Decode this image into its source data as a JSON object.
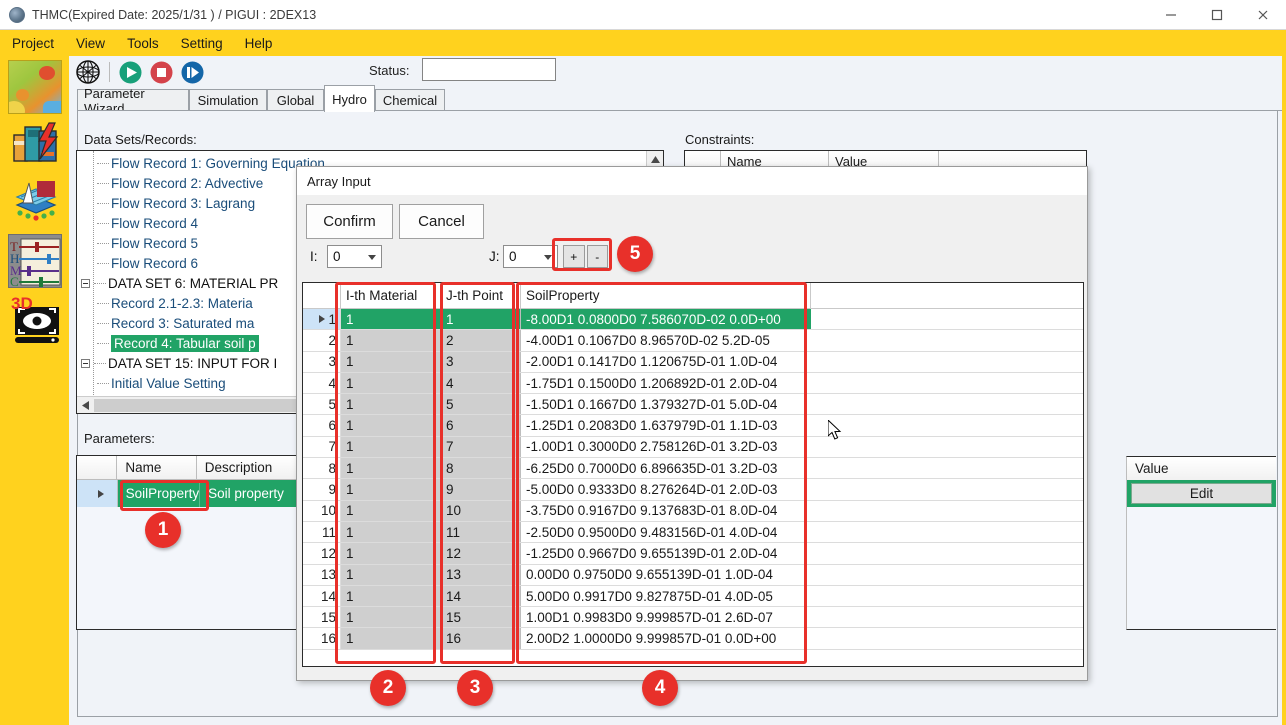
{
  "window": {
    "title": "THMC(Expired Date: 2025/1/31 ) / PIGUI : 2DEX13",
    "minimize": "—",
    "maximize": "□",
    "close": "✕"
  },
  "menubar": {
    "items": [
      {
        "label": "Project"
      },
      {
        "label": "View"
      },
      {
        "label": "Tools"
      },
      {
        "label": "Setting"
      },
      {
        "label": "Help"
      }
    ]
  },
  "toolbar": {
    "globe_icon": "globe-wireframe-icon",
    "run_icon": "run-play-icon",
    "stop_icon": "stop-icon",
    "step_icon": "step-forward-icon",
    "status_label": "Status:",
    "status_value": ""
  },
  "tabs": [
    {
      "label": "Parameter Wizard",
      "active": false
    },
    {
      "label": "Simulation",
      "active": false
    },
    {
      "label": "Global",
      "active": false
    },
    {
      "label": "Hydro",
      "active": true
    },
    {
      "label": "Chemical",
      "active": false
    }
  ],
  "rail": {
    "items": [
      {
        "name": "contour-map-icon"
      },
      {
        "name": "flash-books-icon"
      },
      {
        "name": "mesh-layers-icon"
      },
      {
        "name": "thmc-sliders-icon"
      },
      {
        "name": "3d-view-icon"
      }
    ],
    "thmc_letters": [
      "T",
      "H",
      "M",
      "C"
    ],
    "three_d_label": "3D"
  },
  "sections": {
    "datasets_label": "Data Sets/Records:",
    "constraints_label": "Constraints:",
    "parameters_label": "Parameters:"
  },
  "tree": {
    "nodes": [
      {
        "label": "Flow Record 1: Governing Equation",
        "depth": 2,
        "type": "leaf",
        "selected": false
      },
      {
        "label": "Flow Record 2: Advective",
        "depth": 2,
        "type": "leaf",
        "selected": false
      },
      {
        "label": "Flow Record 3: Lagrang",
        "depth": 2,
        "type": "leaf",
        "selected": false
      },
      {
        "label": "Flow Record 4",
        "depth": 2,
        "type": "leaf",
        "selected": false
      },
      {
        "label": "Flow Record 5",
        "depth": 2,
        "type": "leaf",
        "selected": false
      },
      {
        "label": "Flow Record 6",
        "depth": 2,
        "type": "leaf",
        "selected": false
      },
      {
        "label": "DATA SET 6: MATERIAL PR",
        "depth": 1,
        "type": "group",
        "selected": false
      },
      {
        "label": "Record 2.1-2.3: Materia",
        "depth": 2,
        "type": "leaf",
        "selected": false
      },
      {
        "label": "Record 3: Saturated ma",
        "depth": 2,
        "type": "leaf",
        "selected": false
      },
      {
        "label": "Record 4: Tabular soil p",
        "depth": 2,
        "type": "leaf",
        "selected": true
      },
      {
        "label": "DATA SET 15: INPUT FOR I",
        "depth": 1,
        "type": "group",
        "selected": false
      },
      {
        "label": "Initial Value Setting",
        "depth": 2,
        "type": "leaf",
        "selected": false
      }
    ],
    "scroll_left_arrow": "‹",
    "scroll_up_arrow": "▲"
  },
  "constraints_grid": {
    "columns": [
      "",
      "Name",
      "Value"
    ],
    "rows": []
  },
  "parameters_grid": {
    "columns": [
      "",
      "Name",
      "Description",
      "Value"
    ],
    "rows": [
      {
        "name": "SoilProperty",
        "description": "Soil property",
        "value_button": "Edit",
        "selected": true
      }
    ]
  },
  "dialog": {
    "title": "Array Input",
    "confirm_label": "Confirm",
    "cancel_label": "Cancel",
    "i_label": "I:",
    "i_value": "0",
    "j_label": "J:",
    "j_value": "0",
    "plus_label": "+",
    "minus_label": "-",
    "grid": {
      "columns": [
        "I-th Material",
        "J-th Point",
        "SoilProperty"
      ],
      "rows": [
        {
          "n": "1",
          "material": "1",
          "point": "1",
          "soil": "-8.00D1 0.0800D0 7.586070D-02 0.0D+00",
          "selected": true
        },
        {
          "n": "2",
          "material": "1",
          "point": "2",
          "soil": "-4.00D1 0.1067D0 8.96570D-02 5.2D-05",
          "selected": false
        },
        {
          "n": "3",
          "material": "1",
          "point": "3",
          "soil": "-2.00D1 0.1417D0 1.120675D-01 1.0D-04",
          "selected": false
        },
        {
          "n": "4",
          "material": "1",
          "point": "4",
          "soil": "-1.75D1 0.1500D0 1.206892D-01 2.0D-04",
          "selected": false
        },
        {
          "n": "5",
          "material": "1",
          "point": "5",
          "soil": "-1.50D1 0.1667D0 1.379327D-01 5.0D-04",
          "selected": false
        },
        {
          "n": "6",
          "material": "1",
          "point": "6",
          "soil": "-1.25D1 0.2083D0 1.637979D-01 1.1D-03",
          "selected": false
        },
        {
          "n": "7",
          "material": "1",
          "point": "7",
          "soil": "-1.00D1 0.3000D0 2.758126D-01 3.2D-03",
          "selected": false
        },
        {
          "n": "8",
          "material": "1",
          "point": "8",
          "soil": "-6.25D0 0.7000D0 6.896635D-01 3.2D-03",
          "selected": false
        },
        {
          "n": "9",
          "material": "1",
          "point": "9",
          "soil": "-5.00D0 0.9333D0 8.276264D-01 2.0D-03",
          "selected": false
        },
        {
          "n": "10",
          "material": "1",
          "point": "10",
          "soil": "-3.75D0 0.9167D0 9.137683D-01 8.0D-04",
          "selected": false
        },
        {
          "n": "11",
          "material": "1",
          "point": "11",
          "soil": "-2.50D0 0.9500D0 9.483156D-01 4.0D-04",
          "selected": false
        },
        {
          "n": "12",
          "material": "1",
          "point": "12",
          "soil": "-1.25D0 0.9667D0 9.655139D-01 2.0D-04",
          "selected": false
        },
        {
          "n": "13",
          "material": "1",
          "point": "13",
          "soil": "0.00D0 0.9750D0 9.655139D-01 1.0D-04",
          "selected": false
        },
        {
          "n": "14",
          "material": "1",
          "point": "14",
          "soil": "5.00D0 0.9917D0 9.827875D-01 4.0D-05",
          "selected": false
        },
        {
          "n": "15",
          "material": "1",
          "point": "15",
          "soil": "1.00D1 0.9983D0 9.999857D-01 2.6D-07",
          "selected": false
        },
        {
          "n": "16",
          "material": "1",
          "point": "16",
          "soil": "2.00D2 1.0000D0 9.999857D-01 0.0D+00",
          "selected": false
        }
      ]
    }
  },
  "annotations": {
    "badges": [
      {
        "id": "1",
        "label": "1"
      },
      {
        "id": "2",
        "label": "2"
      },
      {
        "id": "3",
        "label": "3"
      },
      {
        "id": "4",
        "label": "4"
      },
      {
        "id": "5",
        "label": "5"
      }
    ]
  },
  "colors": {
    "accent_yellow": "#ffd21e",
    "selection_green": "#21a366",
    "annotation_red": "#e8302a",
    "panel_bg": "#f0f3f8"
  }
}
